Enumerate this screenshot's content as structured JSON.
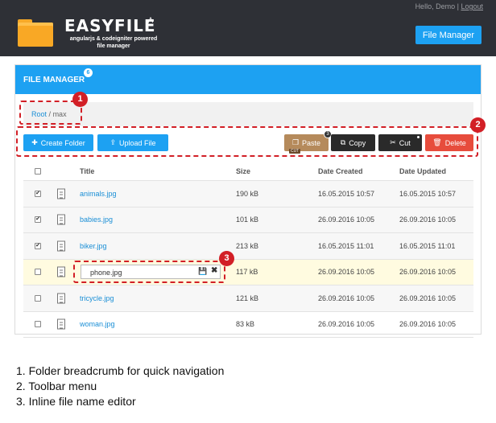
{
  "header": {
    "greeting": "Hello, Demo",
    "separator": "|",
    "logout_label": "Logout",
    "brand_name": "EASYFILE",
    "brand_badge": "A",
    "brand_tagline_1": "angularjs & codeigniter powered",
    "brand_tagline_2": "file manager",
    "file_manager_button": "File Manager"
  },
  "panel": {
    "title": "FILE MANAGER",
    "count_badge": "6"
  },
  "breadcrumb": {
    "root": "Root",
    "separator": "/",
    "current": "max"
  },
  "toolbar": {
    "create_folder": "Create Folder",
    "upload_file": "Upload File",
    "paste": "Paste",
    "paste_count": "3",
    "paste_tag": "CUT",
    "copy": "Copy",
    "cut": "Cut",
    "delete": "Delete"
  },
  "table": {
    "headers": {
      "title": "Title",
      "size": "Size",
      "created": "Date Created",
      "updated": "Date Updated"
    },
    "rows": [
      {
        "title": "animals.jpg",
        "size": "190 kB",
        "created": "16.05.2015 10:57",
        "updated": "16.05.2015 10:57",
        "checked": true
      },
      {
        "title": "babies.jpg",
        "size": "101 kB",
        "created": "26.09.2016 10:05",
        "updated": "26.09.2016 10:05",
        "checked": true
      },
      {
        "title": "biker.jpg",
        "size": "213 kB",
        "created": "16.05.2015 11:01",
        "updated": "16.05.2015 11:01",
        "checked": true
      },
      {
        "title": "phone.jpg",
        "size": "117 kB",
        "created": "26.09.2016 10:05",
        "updated": "26.09.2016 10:05",
        "checked": false,
        "editing": true
      },
      {
        "title": "tricycle.jpg",
        "size": "121 kB",
        "created": "26.09.2016 10:05",
        "updated": "26.09.2016 10:05",
        "checked": false
      },
      {
        "title": "woman.jpg",
        "size": "83 kB",
        "created": "26.09.2016 10:05",
        "updated": "26.09.2016 10:05",
        "checked": false
      }
    ]
  },
  "callouts": {
    "markers": [
      "1",
      "2",
      "3"
    ],
    "legend": [
      "1. Folder breadcrumb for quick navigation",
      "2. Toolbar menu",
      "3. Inline file name editor"
    ]
  },
  "colors": {
    "header_bg": "#2e3036",
    "accent": "#1da1f2",
    "callout": "#d21f26",
    "paste": "#b58a5b",
    "delete": "#e74c3c"
  },
  "icons": [
    "folder-icon",
    "plus-icon",
    "upload-icon",
    "paste-icon",
    "copy-icon",
    "scissors-icon",
    "trash-icon",
    "document-icon",
    "save-icon",
    "close-icon"
  ]
}
